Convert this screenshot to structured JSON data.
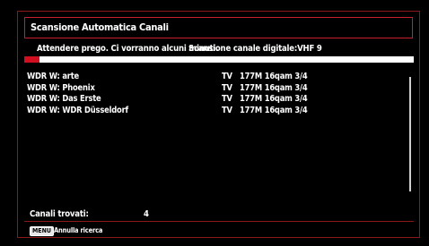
{
  "dialog": {
    "title": "Scansione Automatica Canali",
    "wait_message": "Attendere prego. Ci vorranno alcuni minuti.",
    "scan_status": "Scansione canale digitale:VHF 9"
  },
  "progress": {
    "fraction": 0.04,
    "fill_color": "#d01020"
  },
  "channels": [
    {
      "name": "WDR W: arte",
      "type": "TV",
      "info": "177M 16qam 3/4"
    },
    {
      "name": "WDR W: Phoenix",
      "type": "TV",
      "info": "177M 16qam 3/4"
    },
    {
      "name": "WDR W: Das Erste",
      "type": "TV",
      "info": "177M 16qam 3/4"
    },
    {
      "name": "WDR W: WDR Düsseldorf",
      "type": "TV",
      "info": "177M 16qam 3/4"
    }
  ],
  "footer": {
    "found_label": "Canali trovati:",
    "found_count": "4",
    "menu_key": "MENU",
    "menu_hint": "Annulla ricerca"
  },
  "colors": {
    "accent": "#c8202a",
    "background": "#000000"
  }
}
